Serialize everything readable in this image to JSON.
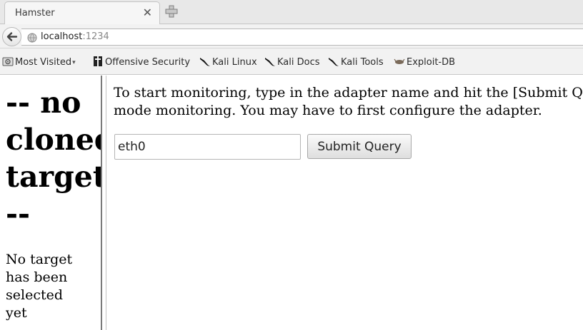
{
  "browser": {
    "tab_title": "Hamster",
    "url_host": "localhost",
    "url_port": ":1234"
  },
  "bookmarks": [
    {
      "label": "Most Visited",
      "icon": "gear-icon",
      "has_dropdown": true
    },
    {
      "label": "Offensive Security",
      "icon": "offsec-icon"
    },
    {
      "label": "Kali Linux",
      "icon": "kali-dragon-icon"
    },
    {
      "label": "Kali Docs",
      "icon": "kali-dragon-icon"
    },
    {
      "label": "Kali Tools",
      "icon": "kali-dragon-icon"
    },
    {
      "label": "Exploit-DB",
      "icon": "exploit-db-icon"
    }
  ],
  "left_frame": {
    "heading_lines": [
      "-- no",
      "cloned",
      "target",
      "--"
    ],
    "status_lines": [
      "No target",
      "has been",
      "selected",
      "yet"
    ]
  },
  "right_frame": {
    "instruction_lines": [
      "To start monitoring, type in the adapter name and hit the [Submit Query]",
      "mode monitoring. You may have to first configure the adapter."
    ],
    "adapter_value": "eth0",
    "submit_label": "Submit Query"
  }
}
